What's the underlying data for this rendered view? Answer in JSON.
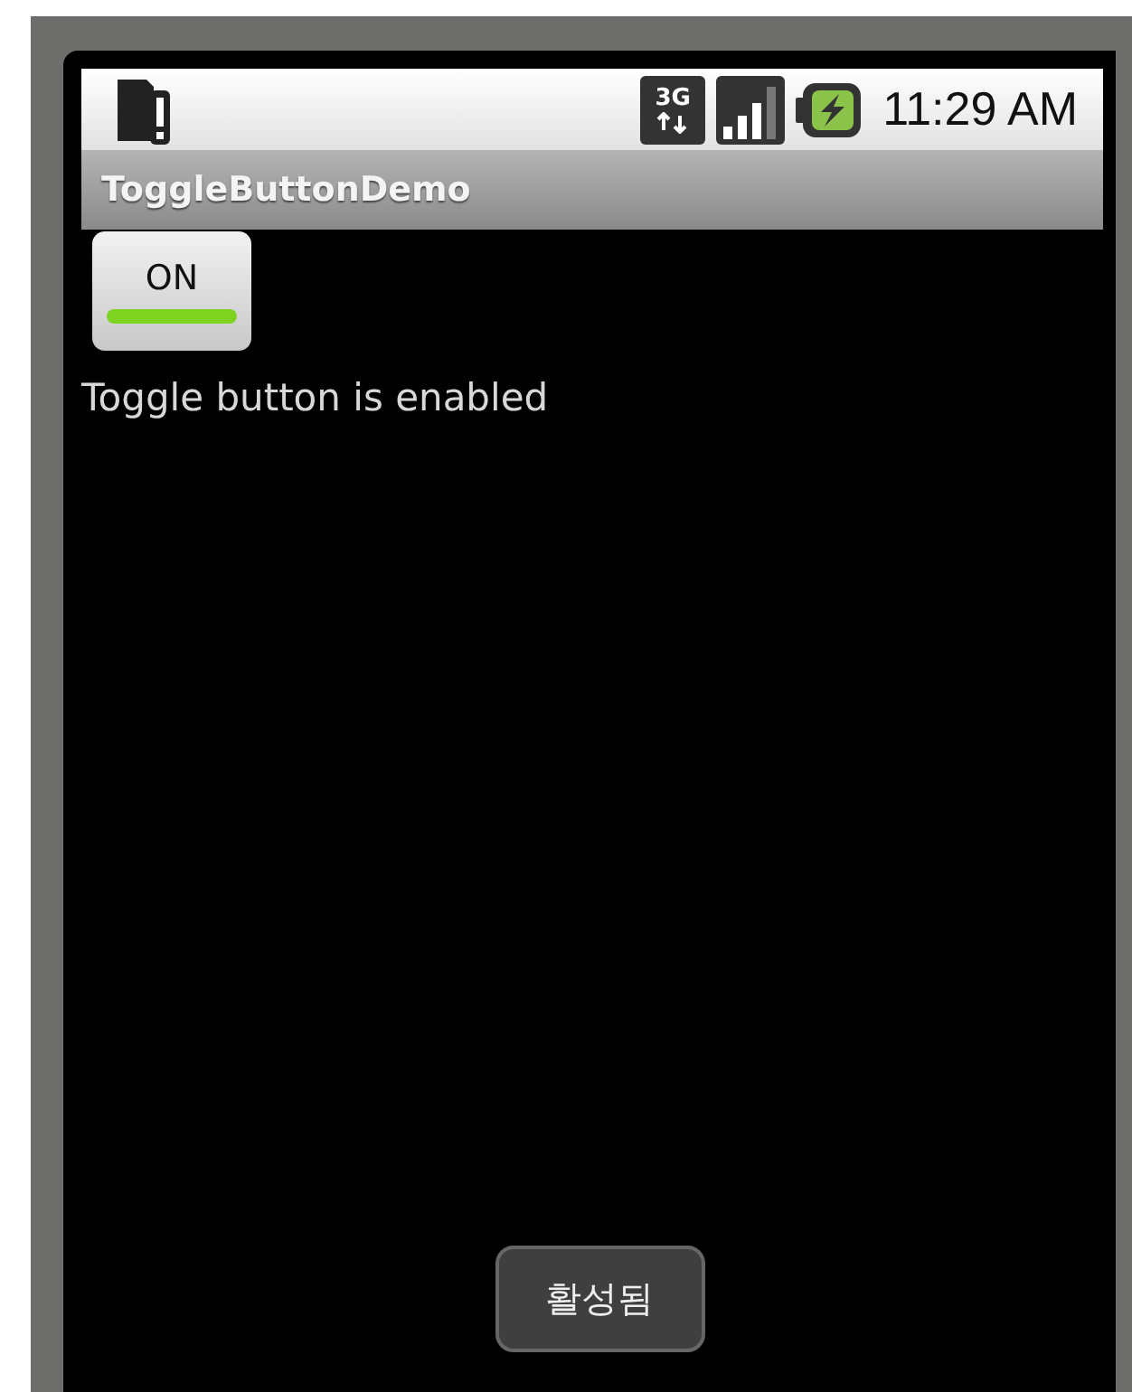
{
  "status_bar": {
    "network_type": "3G",
    "time": "11:29 AM"
  },
  "title_bar": {
    "title": "ToggleButtonDemo"
  },
  "toggle_button": {
    "label": "ON",
    "checked": true
  },
  "message": "Toggle button is enabled",
  "toast": {
    "text": "활성됨"
  }
}
